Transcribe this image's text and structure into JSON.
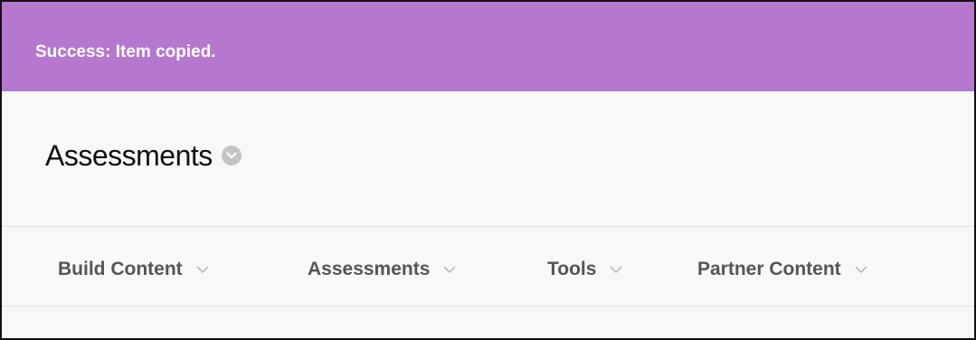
{
  "banner": {
    "message": "Success: Item copied.",
    "color": "#b677cf"
  },
  "page": {
    "title": "Assessments",
    "title_menu_icon": "chevron-down-circle-icon"
  },
  "action_bar": {
    "items": [
      {
        "label": "Build Content",
        "icon": "chevron-down-icon"
      },
      {
        "label": "Assessments",
        "icon": "chevron-down-icon"
      },
      {
        "label": "Tools",
        "icon": "chevron-down-icon"
      },
      {
        "label": "Partner Content",
        "icon": "chevron-down-icon"
      }
    ]
  }
}
